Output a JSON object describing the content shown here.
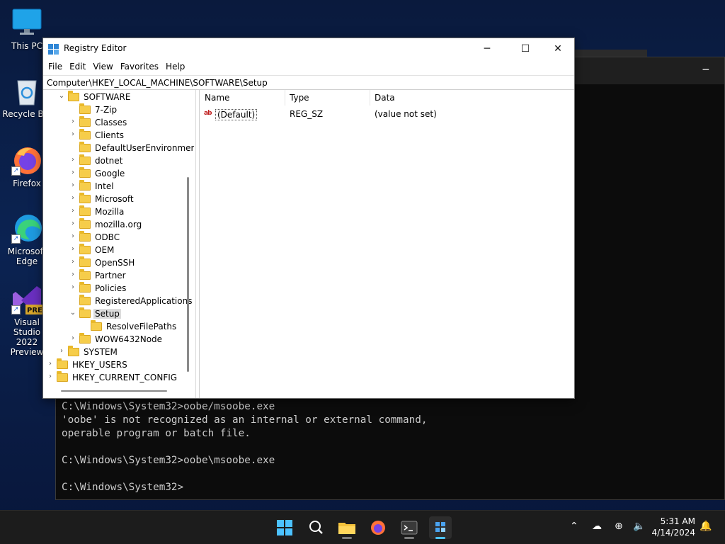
{
  "desktop": {
    "icons": [
      {
        "label": "This PC"
      },
      {
        "label": "Recycle Bin"
      },
      {
        "label": "Firefox"
      },
      {
        "label": "Microsoft Edge"
      },
      {
        "label": "Visual Studio 2022 Preview"
      }
    ]
  },
  "console": {
    "lines": [
      "C:\\Windows\\System32>oobe/msoobe.exe",
      "'oobe' is not recognized as an internal or external command,",
      "operable program or batch file.",
      "",
      "C:\\Windows\\System32>oobe\\msoobe.exe",
      "",
      "C:\\Windows\\System32>"
    ]
  },
  "regedit": {
    "title": "Registry Editor",
    "menu": [
      "File",
      "Edit",
      "View",
      "Favorites",
      "Help"
    ],
    "address": "Computer\\HKEY_LOCAL_MACHINE\\SOFTWARE\\Setup",
    "tree": [
      {
        "label": "SOFTWARE",
        "expanded": true
      },
      {
        "label": "7-Zip"
      },
      {
        "label": "Classes"
      },
      {
        "label": "Clients"
      },
      {
        "label": "DefaultUserEnvironmen"
      },
      {
        "label": "dotnet"
      },
      {
        "label": "Google"
      },
      {
        "label": "Intel"
      },
      {
        "label": "Microsoft"
      },
      {
        "label": "Mozilla"
      },
      {
        "label": "mozilla.org"
      },
      {
        "label": "ODBC"
      },
      {
        "label": "OEM"
      },
      {
        "label": "OpenSSH"
      },
      {
        "label": "Partner"
      },
      {
        "label": "Policies"
      },
      {
        "label": "RegisteredApplications"
      },
      {
        "label": "Setup",
        "expanded": true,
        "selected": true
      },
      {
        "label": "ResolveFilePaths"
      },
      {
        "label": "WOW6432Node"
      },
      {
        "label": "SYSTEM"
      },
      {
        "label": "HKEY_USERS"
      },
      {
        "label": "HKEY_CURRENT_CONFIG"
      }
    ],
    "columns": [
      "Name",
      "Type",
      "Data"
    ],
    "values": [
      {
        "name": "(Default)",
        "type": "REG_SZ",
        "data": "(value not set)"
      }
    ]
  },
  "taskbar": {
    "clock_time": "5:31 AM",
    "clock_date": "4/14/2024",
    "accent": "#4cc2ff"
  }
}
